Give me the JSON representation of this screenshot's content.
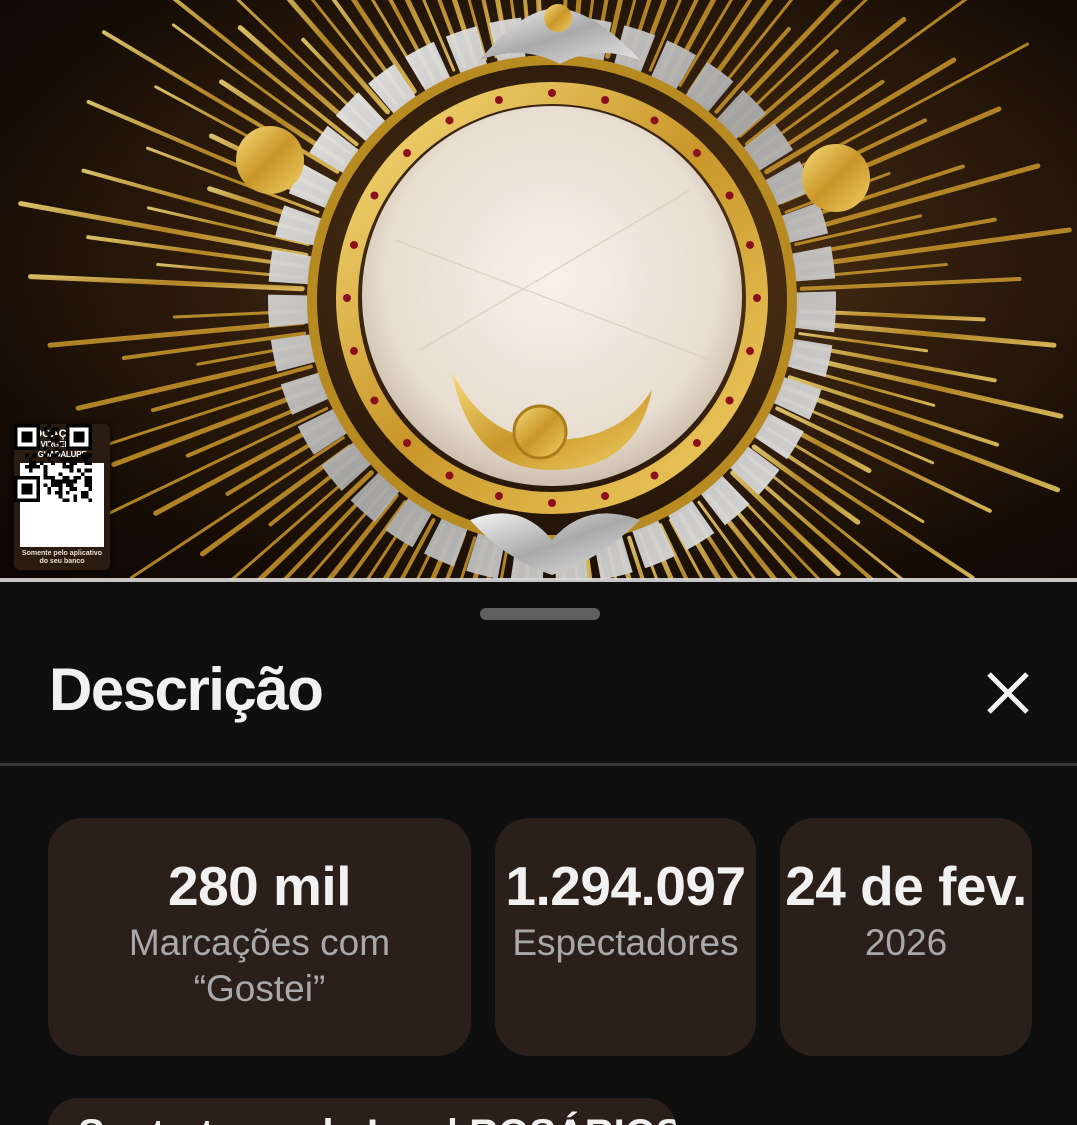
{
  "video": {
    "donation_card": {
      "title": "DOAÇÕES",
      "subtitle": "VIRGEM DE GUADALUPE",
      "note": "Somente pelo aplicativo do seu banco"
    }
  },
  "sheet": {
    "title": "Descrição",
    "close_icon": "close-icon",
    "stats": [
      {
        "value": "280 mil",
        "label": "Marcações com “Gostei”"
      },
      {
        "value": "1.294.097",
        "label": "Espectadores"
      },
      {
        "value": "24 de fev.",
        "label": "2026"
      }
    ],
    "chip_text": "Santo terço da Luz | ROSÁRIOS"
  },
  "colors": {
    "background": "#0f0f0f",
    "card": "#2a2019",
    "text": "#f1f1f1",
    "secondary_text": "#a9a9a9",
    "gold": "#d4a93a"
  }
}
